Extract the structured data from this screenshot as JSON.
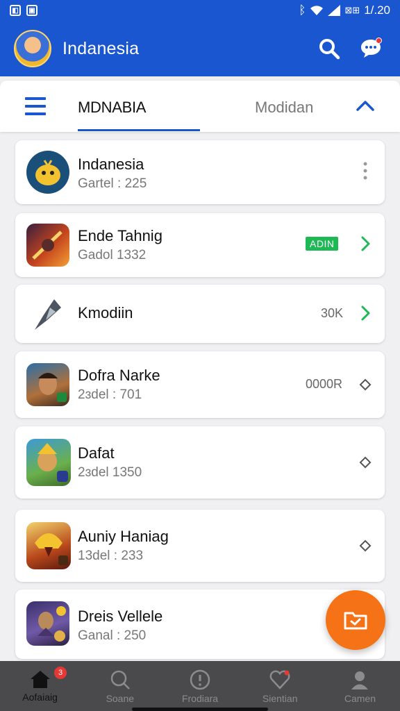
{
  "status_bar": {
    "time": "1/.20",
    "battery_text": "⊠⊞"
  },
  "app_bar": {
    "title": "Indanesia"
  },
  "tabs": {
    "active": "MDNABIA",
    "inactive": "Modidan"
  },
  "list": [
    {
      "title": "Indanesia",
      "subtitle": "Gartel : 225",
      "meta": "",
      "tag": "",
      "trailing_icon": "more-vertical-icon",
      "icon": "blob-character-icon"
    },
    {
      "title": "Ende Tahnig",
      "subtitle": "Gadol 1332",
      "meta": "",
      "tag": "ADIN",
      "trailing_icon": "chevron-right-icon",
      "icon": "warrior-battle-icon"
    },
    {
      "title": "Kmodiin",
      "subtitle": "",
      "meta": "30K",
      "tag": "",
      "trailing_icon": "chevron-right-icon",
      "icon": "blade-icon"
    },
    {
      "title": "Dofra Narke",
      "subtitle": "2ɜdel : 701",
      "meta": "0000R",
      "tag": "",
      "trailing_icon": "diamond-icon",
      "icon": "hero-portrait-icon"
    },
    {
      "title": "Dafat",
      "subtitle": "2ɜdel 1350",
      "meta": "",
      "tag": "",
      "trailing_icon": "diamond-icon",
      "icon": "goblin-warrior-icon"
    },
    {
      "title": "Auniy Haniag",
      "subtitle": "13del : 233",
      "meta": "",
      "tag": "",
      "trailing_icon": "diamond-icon",
      "icon": "golden-helmet-icon"
    },
    {
      "title": "Dreis Vellele",
      "subtitle": "Ganal : 250",
      "meta": "",
      "tag": "",
      "trailing_icon": "",
      "icon": "knight-icon"
    }
  ],
  "bottom_nav": [
    {
      "label": "Aofaiaig",
      "icon": "home-icon",
      "badge": "3",
      "active": true
    },
    {
      "label": "Soane",
      "icon": "search-icon",
      "badge": "",
      "active": false
    },
    {
      "label": "Frodiara",
      "icon": "info-icon",
      "badge": "",
      "active": false
    },
    {
      "label": "Sientian",
      "icon": "heart-icon",
      "badge": "",
      "active": false
    },
    {
      "label": "Camen",
      "icon": "profile-icon",
      "badge": "",
      "active": false
    }
  ],
  "colors": {
    "primary": "#1a56cf",
    "accent": "#f57316",
    "success": "#1db954"
  }
}
